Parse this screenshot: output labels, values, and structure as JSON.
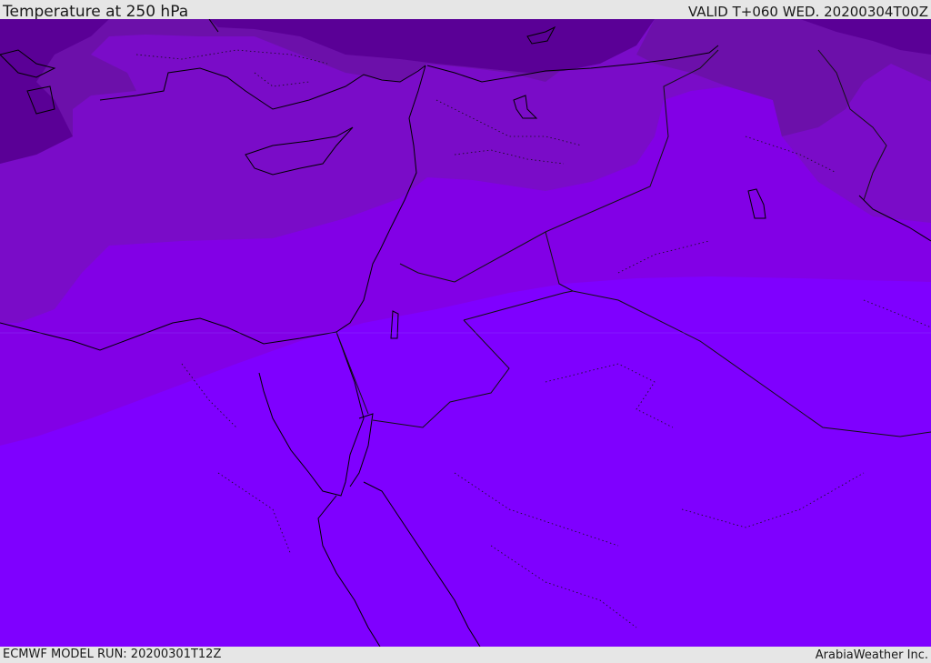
{
  "header": {
    "title": "Temperature at 250 hPa",
    "valid": "VALID T+060 WED. 20200304T00Z"
  },
  "footer": {
    "model_run": "ECMWF MODEL RUN: 20200301T12Z",
    "credit": "ArabiaWeather Inc."
  },
  "map": {
    "region": "Eastern Mediterranean and Middle East",
    "colors": {
      "band_darkest": "#5a0096",
      "band_dark": "#6c10aa",
      "band_mid": "#7a0cc8",
      "band_bright": "#8200e6",
      "band_brightest": "#7f00ff",
      "coastline": "#000000",
      "border": "#1a1a1a"
    }
  }
}
